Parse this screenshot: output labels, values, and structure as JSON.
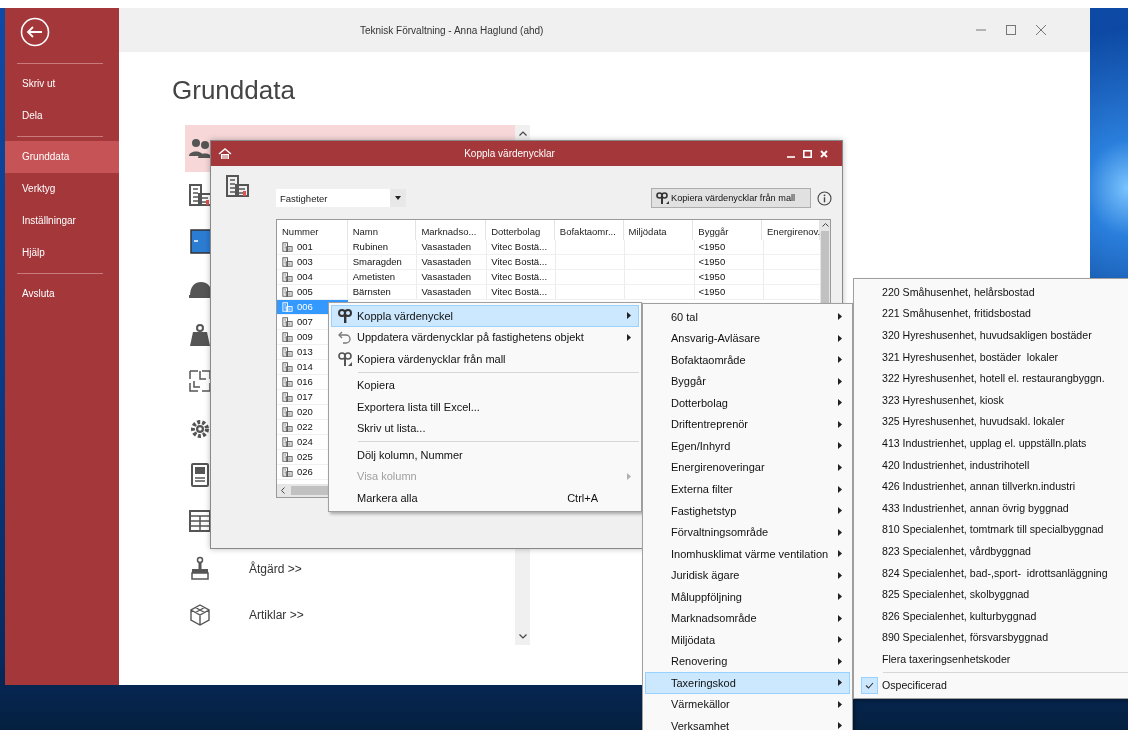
{
  "window": {
    "title": "Teknisk Förvaltning - Anna Haglund (ahd)"
  },
  "sidebar": {
    "groups": [
      [
        {
          "label": "Skriv ut",
          "selected": false
        },
        {
          "label": "Dela",
          "selected": false
        }
      ],
      [
        {
          "label": "Grunddata",
          "selected": true
        },
        {
          "label": "Verktyg",
          "selected": false
        },
        {
          "label": "Inställningar",
          "selected": false
        },
        {
          "label": "Hjälp",
          "selected": false
        }
      ],
      [
        {
          "label": "Avsluta",
          "selected": false
        }
      ]
    ]
  },
  "page": {
    "heading": "Grunddata",
    "tiles": [
      {
        "kind": "people",
        "selected": true
      },
      {
        "kind": "buildings",
        "selected": false
      },
      {
        "kind": "panel",
        "selected": false
      },
      {
        "kind": "helmet",
        "selected": false
      },
      {
        "kind": "weight",
        "selected": false
      },
      {
        "kind": "floorplan",
        "selected": false
      },
      {
        "kind": "gear",
        "selected": false
      },
      {
        "kind": "cabinet",
        "selected": false
      },
      {
        "kind": "table",
        "selected": false
      },
      {
        "kind": "brush",
        "label": "Åtgärd >>",
        "selected": false
      },
      {
        "kind": "cube",
        "label": "Artiklar >>",
        "selected": false
      }
    ]
  },
  "dialog": {
    "title": "Koppla värdenycklar",
    "selector": {
      "value": "Fastigheter"
    },
    "copy_button": "Kopiera värdenycklar från mall",
    "table": {
      "columns": [
        "Nummer",
        "Namn",
        "Marknadso...",
        "Dotterbolag",
        "Bofaktaomr...",
        "Miljödata",
        "Byggår",
        "Energirenov."
      ],
      "rows": [
        {
          "cells": [
            "001",
            "Rubinen",
            "Vasastaden",
            "Vitec Bostä...",
            null,
            null,
            "<1950"
          ],
          "selected": false
        },
        {
          "cells": [
            "003",
            "Smaragden",
            "Vasastaden",
            "Vitec Bostä...",
            null,
            null,
            "<1950"
          ],
          "selected": false
        },
        {
          "cells": [
            "004",
            "Ametisten",
            "Vasastaden",
            "Vitec Bostä...",
            null,
            null,
            "<1950"
          ],
          "selected": false
        },
        {
          "cells": [
            "005",
            "Bärnsten",
            "Vasastaden",
            "Vitec Bostä...",
            null,
            null,
            "<1950"
          ],
          "selected": false
        },
        {
          "cells": [
            "006"
          ],
          "selected": true
        },
        {
          "cells": [
            "007"
          ],
          "selected": false
        },
        {
          "cells": [
            "009"
          ],
          "selected": false
        },
        {
          "cells": [
            "013"
          ],
          "selected": false
        },
        {
          "cells": [
            "014"
          ],
          "selected": false
        },
        {
          "cells": [
            "016"
          ],
          "selected": false
        },
        {
          "cells": [
            "017"
          ],
          "selected": false
        },
        {
          "cells": [
            "020"
          ],
          "selected": false
        },
        {
          "cells": [
            "022"
          ],
          "selected": false
        },
        {
          "cells": [
            "024"
          ],
          "selected": false
        },
        {
          "cells": [
            "025"
          ],
          "selected": false
        },
        {
          "cells": [
            "026"
          ],
          "selected": false
        }
      ]
    }
  },
  "context_menu": {
    "groups": [
      [
        {
          "label": "Koppla värdenyckel",
          "submenu": true,
          "selected": true,
          "disabled": false
        },
        {
          "label": "Uppdatera värdenycklar på fastighetens objekt",
          "submenu": true,
          "selected": false,
          "disabled": false
        },
        {
          "label": "Kopiera värdenycklar från mall",
          "submenu": false,
          "selected": false,
          "disabled": false
        }
      ],
      [
        {
          "label": "Kopiera",
          "submenu": false,
          "selected": false,
          "disabled": false
        },
        {
          "label": "Exportera lista till Excel...",
          "submenu": false,
          "selected": false,
          "disabled": false
        },
        {
          "label": "Skriv ut lista...",
          "submenu": false,
          "selected": false,
          "disabled": false
        }
      ],
      [
        {
          "label": "Dölj kolumn, Nummer",
          "submenu": false,
          "selected": false,
          "disabled": false
        },
        {
          "label": "Visa kolumn",
          "submenu": true,
          "selected": false,
          "disabled": true
        },
        {
          "label": "Markera alla",
          "shortcut": "Ctrl+A",
          "submenu": false,
          "selected": false,
          "disabled": false
        }
      ]
    ]
  },
  "submenu": {
    "items": [
      {
        "label": "60 tal",
        "selected": false
      },
      {
        "label": "Ansvarig-Avläsare",
        "selected": false
      },
      {
        "label": "Bofaktaområde",
        "selected": false
      },
      {
        "label": "Byggår",
        "selected": false
      },
      {
        "label": "Dotterbolag",
        "selected": false
      },
      {
        "label": "Driftentreprenör",
        "selected": false
      },
      {
        "label": "Egen/Inhyrd",
        "selected": false
      },
      {
        "label": "Energirenoveringar",
        "selected": false
      },
      {
        "label": "Externa filter",
        "selected": false
      },
      {
        "label": "Fastighetstyp",
        "selected": false
      },
      {
        "label": "Förvaltningsområde",
        "selected": false
      },
      {
        "label": "Inomhusklimat värme ventilation",
        "selected": false
      },
      {
        "label": "Juridisk ägare",
        "selected": false
      },
      {
        "label": "Måluppföljning",
        "selected": false
      },
      {
        "label": "Marknadsområde",
        "selected": false
      },
      {
        "label": "Miljödata",
        "selected": false
      },
      {
        "label": "Renovering",
        "selected": false
      },
      {
        "label": "Taxeringskod",
        "selected": true
      },
      {
        "label": "Värmekällor",
        "selected": false
      },
      {
        "label": "Verksamhet",
        "selected": false
      }
    ]
  },
  "value_submenu": {
    "groups": [
      [
        {
          "label": "220 Småhusenhet, helårsbostad",
          "checked": false
        },
        {
          "label": "221 Småhusenhet, fritidsbostad",
          "checked": false
        },
        {
          "label": "320 Hyreshusenhet, huvudsakligen bostäder",
          "checked": false
        },
        {
          "label": "321 Hyreshusenhet, bostäder  lokaler",
          "checked": false
        },
        {
          "label": "322 Hyreshusenhet, hotell el. restaurangbyggn.",
          "checked": false
        },
        {
          "label": "323 Hyreshusenhet, kiosk",
          "checked": false
        },
        {
          "label": "325 Hyreshusenhet, huvudsakl. lokaler",
          "checked": false
        },
        {
          "label": "413 Industrienhet, upplag el. uppställn.plats",
          "checked": false
        },
        {
          "label": "420 Industrienhet, industrihotell",
          "checked": false
        },
        {
          "label": "426 Industrienhet, annan tillverkn.industri",
          "checked": false
        },
        {
          "label": "433 Industrienhet, annan övrig byggnad",
          "checked": false
        },
        {
          "label": "810 Specialenhet, tomtmark till specialbyggnad",
          "checked": false
        },
        {
          "label": "823 Specialenhet, vårdbyggnad",
          "checked": false
        },
        {
          "label": "824 Specialenhet, bad-,sport-  idrottsanläggning",
          "checked": false
        },
        {
          "label": "825 Specialenhet, skolbyggnad",
          "checked": false
        },
        {
          "label": "826 Specialenhet, kulturbyggnad",
          "checked": false
        },
        {
          "label": "890 Specialenhet, försvarsbyggnad",
          "checked": false
        },
        {
          "label": "Flera taxeringsenhetskoder",
          "checked": false
        }
      ],
      [
        {
          "label": "Ospecificerad",
          "checked": true
        }
      ]
    ]
  }
}
